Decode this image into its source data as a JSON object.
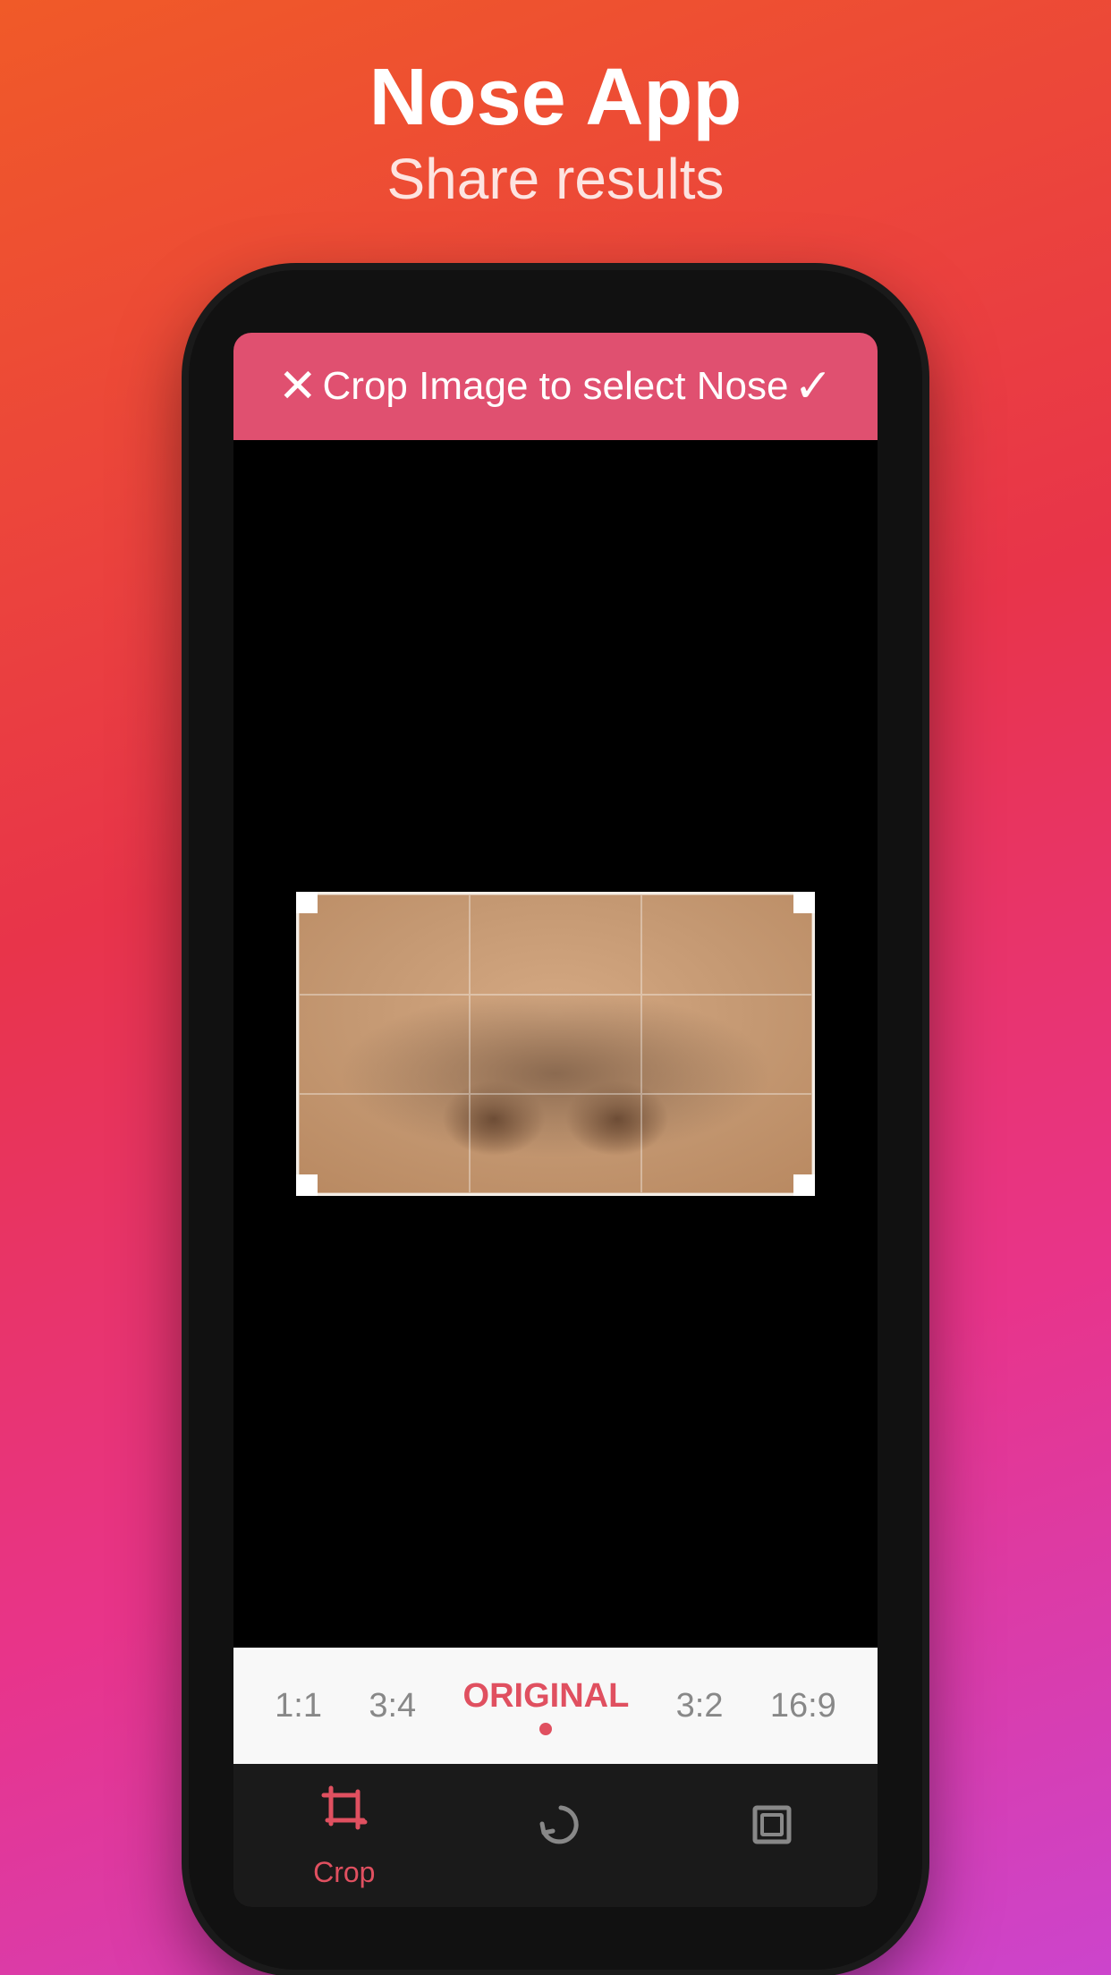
{
  "app": {
    "title": "Nose App",
    "subtitle": "Share results"
  },
  "header": {
    "close_label": "✕",
    "title": "Crop Image to select Nose",
    "confirm_label": "✓"
  },
  "ratio_bar": {
    "options": [
      {
        "id": "1:1",
        "label": "1:1",
        "active": false
      },
      {
        "id": "3:4",
        "label": "3:4",
        "active": false
      },
      {
        "id": "original",
        "label": "ORIGINAL",
        "active": true
      },
      {
        "id": "3:2",
        "label": "3:2",
        "active": false
      },
      {
        "id": "16:9",
        "label": "16:9",
        "active": false
      }
    ]
  },
  "toolbar": {
    "items": [
      {
        "id": "crop",
        "label": "Crop",
        "icon": "crop",
        "active": true
      },
      {
        "id": "rotate",
        "label": "",
        "icon": "rotate",
        "active": false
      },
      {
        "id": "expand",
        "label": "",
        "icon": "expand",
        "active": false
      }
    ]
  },
  "colors": {
    "accent": "#e05070",
    "background_gradient_start": "#f05a28",
    "background_gradient_end": "#cc44cc",
    "phone_bg": "#111",
    "screen_bg": "#000"
  }
}
